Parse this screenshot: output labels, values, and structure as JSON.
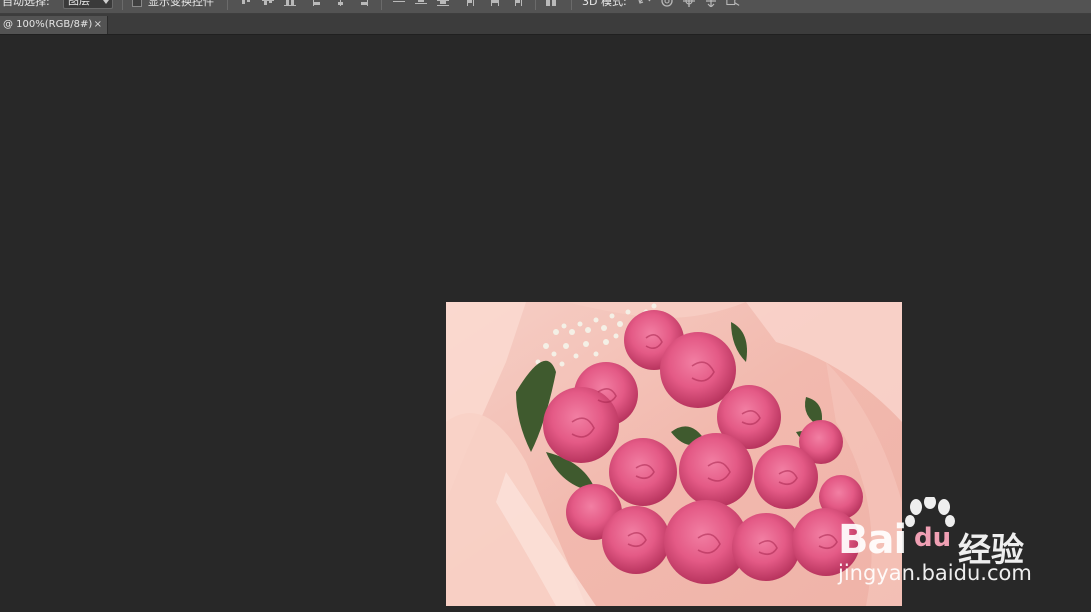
{
  "options_bar": {
    "auto_select_label": "自动选择:",
    "auto_select_value": "图层",
    "show_transform_label": "显示变换控件",
    "mode_label": "3D 模式:"
  },
  "document_tab": {
    "title": "@ 100%(RGB/8#)",
    "close_label": "×"
  },
  "image": {
    "description_icon": "rose-bouquet-photo"
  },
  "watermark": {
    "brand": "Bai",
    "brand_suffix": "du",
    "product": "经验",
    "url": "jingyan.baidu.com"
  },
  "colors": {
    "canvas_bg": "#282828",
    "toolbar_bg": "#535353",
    "tab_bg": "#535353"
  }
}
